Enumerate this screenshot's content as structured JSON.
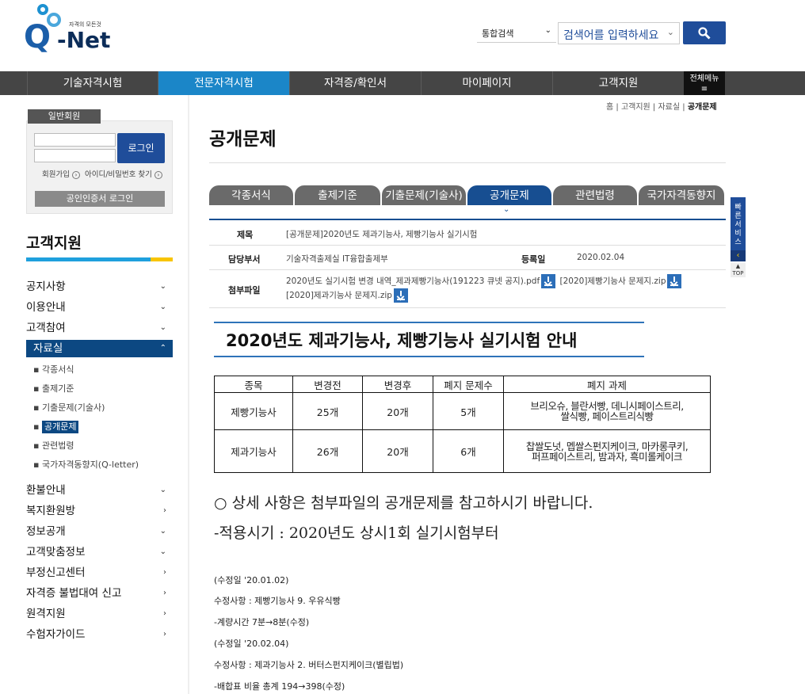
{
  "header": {
    "logo_tagline": "자격의 모든것",
    "logo_q": "Q",
    "logo_net": "-Net",
    "search_category": "통합검색",
    "search_placeholder": "검색어를 입력하세요"
  },
  "gnb": {
    "items": [
      "기술자격시험",
      "전문자격시험",
      "자격증/확인서",
      "마이페이지",
      "고객지원"
    ],
    "all_menu": "전체메뉴",
    "active_index": 1
  },
  "login": {
    "member_tab": "일반회원",
    "login_button": "로그인",
    "join_link": "회원가입",
    "find_link": "아이디/비밀번호 찾기",
    "cert_button": "공인인증서 로그인"
  },
  "sidebar": {
    "title": "고객지원",
    "items": [
      "공지사항",
      "이용안내",
      "고객참여",
      "자료실",
      "환불안내",
      "복지환원방",
      "정보공개",
      "고객맞춤정보",
      "부정신고센터",
      "자격증 불법대여 신고",
      "원격지원",
      "수험자가이드"
    ],
    "sub_items": [
      "각종서식",
      "출제기준",
      "기출문제(기술사)",
      "공개문제",
      "관련법령",
      "국가자격동향지(Q-letter)"
    ]
  },
  "breadcrumb": {
    "home": "홈",
    "level1": "고객지원",
    "level2": "자료실",
    "current": "공개문제"
  },
  "page_title": "공개문제",
  "tabs": [
    "각종서식",
    "출제기준",
    "기출문제(기술사)",
    "공개문제",
    "관련법령",
    "국가자격동향지"
  ],
  "post": {
    "title_label": "제목",
    "title": "[공개문제]2020년도 제과기능사, 제빵기능사 실기시험",
    "dept_label": "담당부서",
    "dept": "기술자격출제실 IT융합출제부",
    "date_label": "등록일",
    "date": "2020.02.04",
    "attach_label": "첨부파일",
    "files": [
      "2020년도 실기시험 변경 내역_제과제빵기능사(191223 큐넷 공지).pdf",
      "[2020]제빵기능사 문제지.zip",
      "[2020]제과기능사 문제지.zip"
    ]
  },
  "content": {
    "heading": "2020년도 제과기능사, 제빵기능사 실기시험 안내",
    "table_headers": [
      "종목",
      "변경전",
      "변경후",
      "폐지 문제수",
      "폐지 과제"
    ],
    "rows": [
      {
        "item": "제빵기능사",
        "before": "25개",
        "after": "20개",
        "removed": "5개",
        "tasks_line1": "브리오슈, 블란서빵, 데니시페이스트리,",
        "tasks_line2": "쌀식빵, 페이스트리식빵"
      },
      {
        "item": "제과기능사",
        "before": "26개",
        "after": "20개",
        "removed": "6개",
        "tasks_line1": "찹쌀도넛, 멥쌀스펀지케이크, 마카롱쿠키,",
        "tasks_line2": "퍼프페이스트리, 밤과자, 흑미롤케이크"
      }
    ],
    "note1": "○ 상세 사항은 첨부파일의 공개문제를 참고하시기 바랍니다.",
    "note2": "-적용시기 : 2020년도 상시1회 실기시험부터",
    "revisions": [
      "(수정일 '20.01.02)",
      "수정사항 : 제빵기능사 9. 우유식빵",
      "-계량시간 7분→8분(수정)",
      "(수정일 '20.02.04)",
      "수정사항 : 제과기능사 2. 버터스펀지케이크(별립법)",
      "-배합표 비율 총계 194→398(수정)"
    ]
  },
  "quick": {
    "label": "빠른서비스",
    "top": "TOP"
  }
}
